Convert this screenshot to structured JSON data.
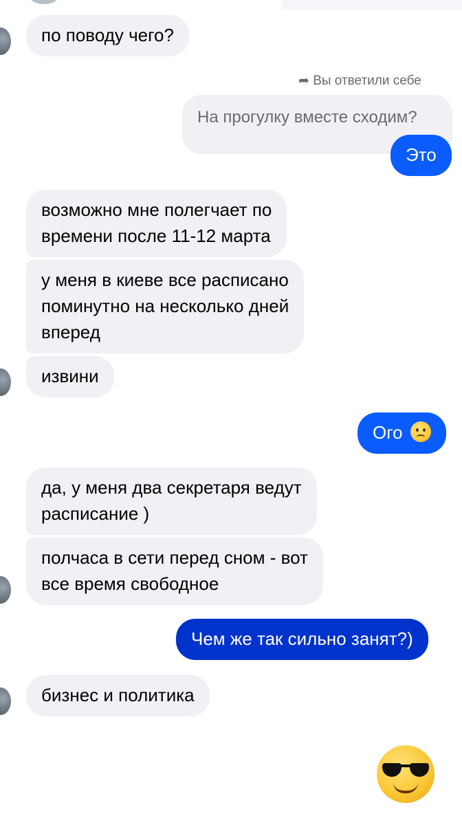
{
  "messages": [
    {
      "id": "m1",
      "direction": "incoming",
      "text": "по поводу чего?"
    },
    {
      "id": "m2",
      "direction": "outgoing",
      "reply_header": "Вы ответили себе",
      "reply_quote": "На прогулку вместе сходим?",
      "text": "Это"
    },
    {
      "id": "m3",
      "direction": "incoming",
      "lines": [
        "возможно мне полегчает по",
        "времени после 11-12 марта"
      ]
    },
    {
      "id": "m4",
      "direction": "incoming",
      "lines": [
        "у меня в киеве все расписано",
        "поминутно на несколько дней",
        "вперед"
      ]
    },
    {
      "id": "m5",
      "direction": "incoming",
      "text": "извини"
    },
    {
      "id": "m6",
      "direction": "outgoing",
      "text": "Ого",
      "emoji": "worried-face"
    },
    {
      "id": "m7",
      "direction": "incoming",
      "lines": [
        "да, у меня два секретаря ведут",
        "расписание )"
      ]
    },
    {
      "id": "m8",
      "direction": "incoming",
      "lines": [
        "полчаса в сети перед сном - вот",
        "все время свободное"
      ]
    },
    {
      "id": "m9",
      "direction": "outgoing",
      "text": "Чем же так сильно занят?)"
    },
    {
      "id": "m10",
      "direction": "incoming",
      "text": "бизнес и политика"
    },
    {
      "id": "m11",
      "direction": "outgoing",
      "sticker": "smiling-face-with-sunglasses"
    }
  ],
  "colors": {
    "incoming_bubble": "#f0f0f5",
    "outgoing_bubble": "#0a5cff",
    "outgoing_bubble_dark": "#0033cc",
    "meta_text": "#6a6a6f"
  }
}
